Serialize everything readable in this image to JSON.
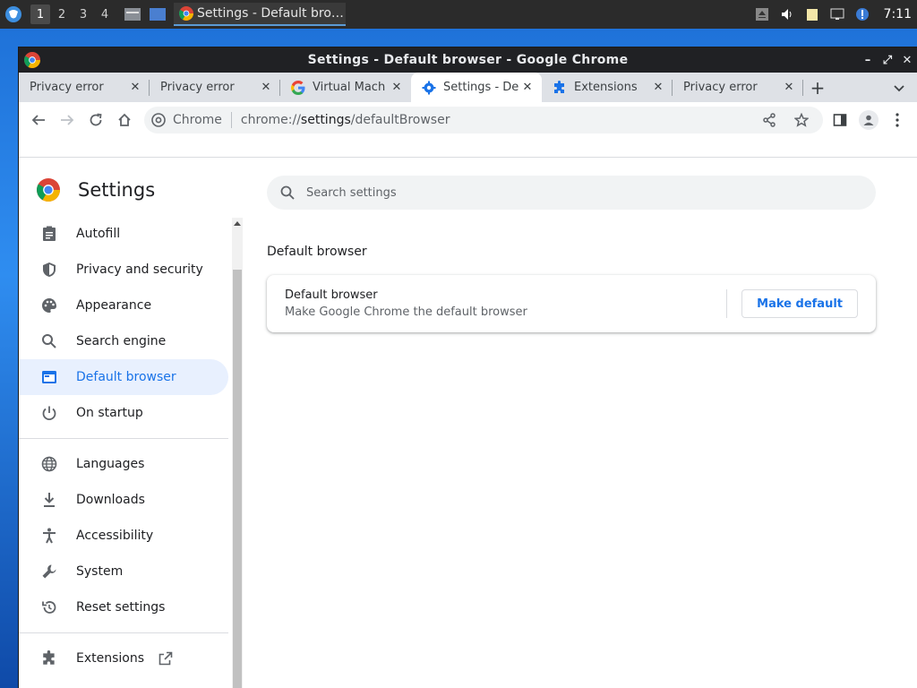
{
  "taskbar": {
    "workspaces": [
      "1",
      "2",
      "3",
      "4"
    ],
    "task_title": "Settings - Default bro…",
    "clock": "7:11"
  },
  "window": {
    "title": "Settings - Default browser - Google Chrome"
  },
  "tabs": [
    {
      "title": "Privacy error",
      "icon": "none"
    },
    {
      "title": "Privacy error",
      "icon": "none"
    },
    {
      "title": "Virtual Mach",
      "icon": "google-icon"
    },
    {
      "title": "Settings - De",
      "icon": "gear-icon",
      "active": true
    },
    {
      "title": "Extensions",
      "icon": "puzzle-icon"
    },
    {
      "title": "Privacy error",
      "icon": "none"
    }
  ],
  "omnibox": {
    "chip": "Chrome",
    "url_prefix": "chrome://",
    "url_host": "settings",
    "url_path": "/defaultBrowser"
  },
  "settings": {
    "app_name": "Settings",
    "search_placeholder": "Search settings",
    "nav_group1": [
      {
        "label": "Autofill",
        "icon": "clipboard-icon"
      },
      {
        "label": "Privacy and security",
        "icon": "shield-icon"
      },
      {
        "label": "Appearance",
        "icon": "palette-icon"
      },
      {
        "label": "Search engine",
        "icon": "search-icon"
      },
      {
        "label": "Default browser",
        "icon": "browser-icon",
        "selected": true
      },
      {
        "label": "On startup",
        "icon": "power-icon"
      }
    ],
    "nav_group2": [
      {
        "label": "Languages",
        "icon": "globe-icon"
      },
      {
        "label": "Downloads",
        "icon": "download-icon"
      },
      {
        "label": "Accessibility",
        "icon": "accessibility-icon"
      },
      {
        "label": "System",
        "icon": "wrench-icon"
      },
      {
        "label": "Reset settings",
        "icon": "reset-icon"
      }
    ],
    "nav_group3": [
      {
        "label": "Extensions",
        "icon": "puzzle-icon"
      }
    ],
    "section_title": "Default browser",
    "card": {
      "primary": "Default browser",
      "secondary": "Make Google Chrome the default browser",
      "button": "Make default"
    }
  },
  "colors": {
    "accent": "#1a73e8",
    "selected_bg": "#e8f0fe",
    "titlebar": "#202124",
    "tabstrip": "#dee1e6"
  }
}
